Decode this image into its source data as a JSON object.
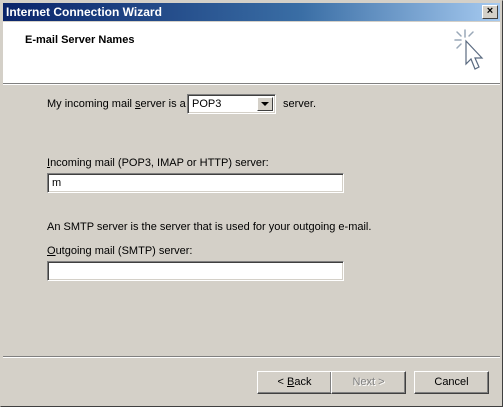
{
  "window": {
    "title": "Internet Connection Wizard",
    "close_glyph": "×"
  },
  "header": {
    "title": "E-mail Server Names",
    "icon": "wizard-cursor-icon"
  },
  "form": {
    "incoming_type_prefix": "My incoming mail ",
    "incoming_type_hotkey": "s",
    "incoming_type_mid": "erver is a",
    "incoming_type_value": "POP3",
    "incoming_type_suffix": "server.",
    "incoming_server_hotkey": "I",
    "incoming_server_label": "ncoming mail (POP3, IMAP or HTTP) server:",
    "incoming_server_value": "m",
    "smtp_info": "An SMTP server is the server that is used for your outgoing e-mail.",
    "outgoing_server_hotkey": "O",
    "outgoing_server_label": "utgoing mail (SMTP) server:",
    "outgoing_server_value": ""
  },
  "buttons": {
    "back_prefix": "< ",
    "back_hotkey": "B",
    "back_rest": "ack",
    "next_label": "Next >",
    "cancel_label": "Cancel"
  }
}
